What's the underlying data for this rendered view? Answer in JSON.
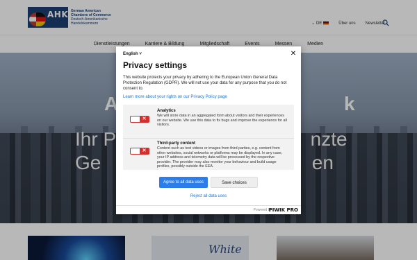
{
  "header": {
    "logo_abbr": "AHK",
    "logo_line1": "German American",
    "logo_line2": "Chambers of Commerce",
    "logo_line3": "Deutsch-Amerikanische",
    "logo_line4": "Handelskammern",
    "lang": "DE",
    "link_about": "Über uns",
    "link_newsletter": "Newsletter"
  },
  "nav": {
    "items": [
      "Dienstleistungen",
      "Karriere & Bildung",
      "Mitgliedschaft",
      "Events",
      "Messen",
      "Medien"
    ]
  },
  "hero": {
    "title": "A                                     k",
    "subtitle": "Ihr P                                    nzte Ge                                       en"
  },
  "cards": {
    "white_label": "White"
  },
  "modal": {
    "language": "English",
    "title": "Privacy settings",
    "description": "This website protects your privacy by adhering to the European Union General Data Protection Regulation (GDPR). We will not use your data for any purpose that you do not consent to.",
    "privacy_link": "Learn more about your rights on our Privacy Policy page",
    "categories": [
      {
        "name": "Analytics",
        "description": "We will store data in an aggregated form about visitors and their experiences on our website. We use this data to fix bugs and improve the experience for all visitors."
      },
      {
        "name": "Third-party content",
        "description": "Content such as text videos or images from third parties, e.g. content from other websites, social networks or platforms may be displayed. In any case, your IP address and telemetry data will be processed by the respective provider. The provider may also monitor your behaviour and build usage profiles, possibly outside the EEA."
      }
    ],
    "agree_label": "Agree to all data uses",
    "save_label": "Save choices",
    "reject_label": "Reject all data uses",
    "powered_by": "Powered by",
    "brand": "PIWIK PRO"
  },
  "colors": {
    "accent_blue": "#2b7de9",
    "toggle_red": "#d32f2f",
    "brand_navy": "#1c3f72"
  }
}
